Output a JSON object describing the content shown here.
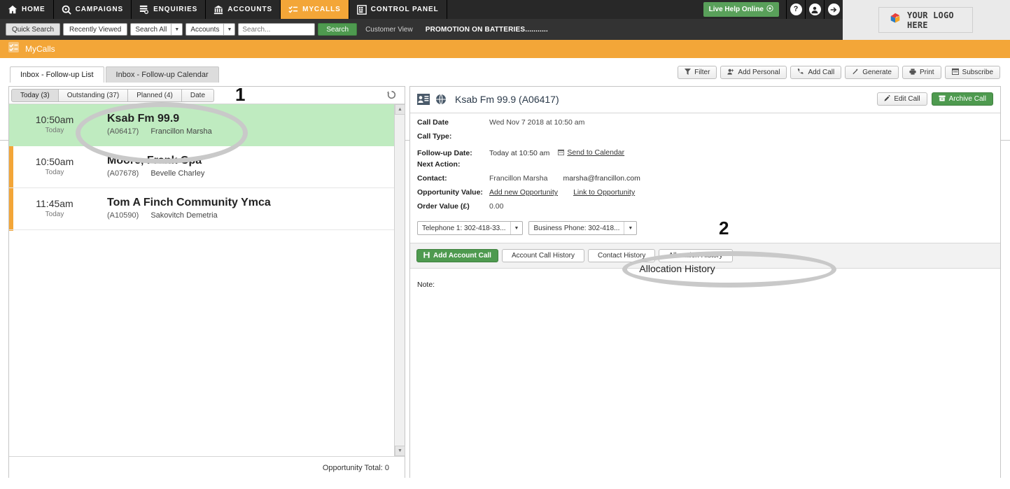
{
  "topnav": {
    "items": [
      {
        "label": "HOME",
        "icon": "home-icon",
        "active": false
      },
      {
        "label": "CAMPAIGNS",
        "icon": "megaphone-icon",
        "active": false
      },
      {
        "label": "ENQUIRIES",
        "icon": "list-search-icon",
        "active": false
      },
      {
        "label": "ACCOUNTS",
        "icon": "bank-icon",
        "active": false
      },
      {
        "label": "MYCALLS",
        "icon": "checklist-icon",
        "active": true
      },
      {
        "label": "CONTROL PANEL",
        "icon": "grid-icon",
        "active": false
      }
    ],
    "live_help": "Live Help Online",
    "help_icon": "question-mark-icon",
    "user_icon": "user-head-icon",
    "logout_icon": "arrow-right-icon",
    "active_color": "#F3A638",
    "bar_color": "#282828"
  },
  "logo": {
    "text": "YOUR LOGO HERE",
    "icon": "cube-logo-icon"
  },
  "searchbar": {
    "quick_search": "Quick Search",
    "recently_viewed": "Recently Viewed",
    "scope_select": "Search All",
    "type_select": "Accounts",
    "search_placeholder": "Search...",
    "search_button": "Search",
    "customer_view": "Customer View",
    "promo": "PROMOTION ON BATTERIES..........."
  },
  "module": {
    "title": "MyCalls",
    "icon": "checklist-icon",
    "color": "#F3A638"
  },
  "page_tabs": [
    {
      "label": "Inbox - Follow-up List",
      "active": true
    },
    {
      "label": "Inbox - Follow-up Calendar",
      "active": false
    }
  ],
  "toolbar": [
    {
      "label": "Filter",
      "icon": "funnel-icon"
    },
    {
      "label": "Add Personal",
      "icon": "person-add-icon"
    },
    {
      "label": "Add Call",
      "icon": "phone-icon"
    },
    {
      "label": "Generate",
      "icon": "wand-icon"
    },
    {
      "label": "Print",
      "icon": "printer-icon"
    },
    {
      "label": "Subscribe",
      "icon": "calendar-icon"
    }
  ],
  "left_panel": {
    "filter_tabs": [
      {
        "label": "Today (3)",
        "active": true
      },
      {
        "label": "Outstanding (37)",
        "active": false
      },
      {
        "label": "Planned (4)",
        "active": false
      },
      {
        "label": "Date",
        "active": false
      }
    ],
    "refresh_icon": "refresh-icon",
    "rows": [
      {
        "time": "10:50am",
        "day": "Today",
        "name": "Ksab Fm 99.9",
        "account": "(A06417)",
        "contact": "Francillon Marsha",
        "selected": true
      },
      {
        "time": "10:50am",
        "day": "Today",
        "name": "Moore, Frank Cpa",
        "account": "(A07678)",
        "contact": "Bevelle Charley",
        "selected": false
      },
      {
        "time": "11:45am",
        "day": "Today",
        "name": "Tom A Finch Community Ymca",
        "account": "(A10590)",
        "contact": "Sakovitch Demetria",
        "selected": false
      }
    ],
    "footer": "Opportunity Total: 0",
    "highlight_color": "#BFEBC0",
    "rail_color": "#F3A638"
  },
  "right_panel": {
    "title": "Ksab Fm 99.9 (A06417)",
    "icon_account": "account-card-icon",
    "icon_globe": "globe-icon",
    "edit_button": "Edit Call",
    "edit_icon": "pencil-icon",
    "archive_button": "Archive Call",
    "archive_icon": "archive-box-icon",
    "fields": [
      {
        "label": "Call Date",
        "value": "Wed Nov 7 2018 at 10:50 am"
      },
      {
        "label": "Call Type:",
        "value": ""
      },
      {
        "label": "Follow-up Date:",
        "value": "Today at 10:50 am",
        "link": "Send to Calendar",
        "link_icon": "calendar-icon"
      },
      {
        "label": "Next Action:",
        "value": ""
      },
      {
        "label": "Contact:",
        "value": "Francillon Marsha",
        "email": "marsha@francillon.com"
      },
      {
        "label": "Opportunity Value:",
        "links": [
          "Add new Opportunity",
          "Link to Opportunity"
        ]
      },
      {
        "label": "Order Value (£)",
        "value": "0.00"
      }
    ],
    "phones": [
      {
        "label": "Telephone 1: 302-418-33..."
      },
      {
        "label": "Business Phone: 302-418..."
      }
    ],
    "history_bar": {
      "add_account_call": "Add Account Call",
      "add_icon": "save-icon",
      "tabs": [
        {
          "label": "Account Call History"
        },
        {
          "label": "Contact History"
        },
        {
          "label": "Allocation History"
        }
      ]
    },
    "note_label": "Note:"
  },
  "annotations": [
    {
      "number": "1",
      "target": "selected-call-row"
    },
    {
      "number": "2",
      "target": "allocation-history-tab"
    }
  ]
}
